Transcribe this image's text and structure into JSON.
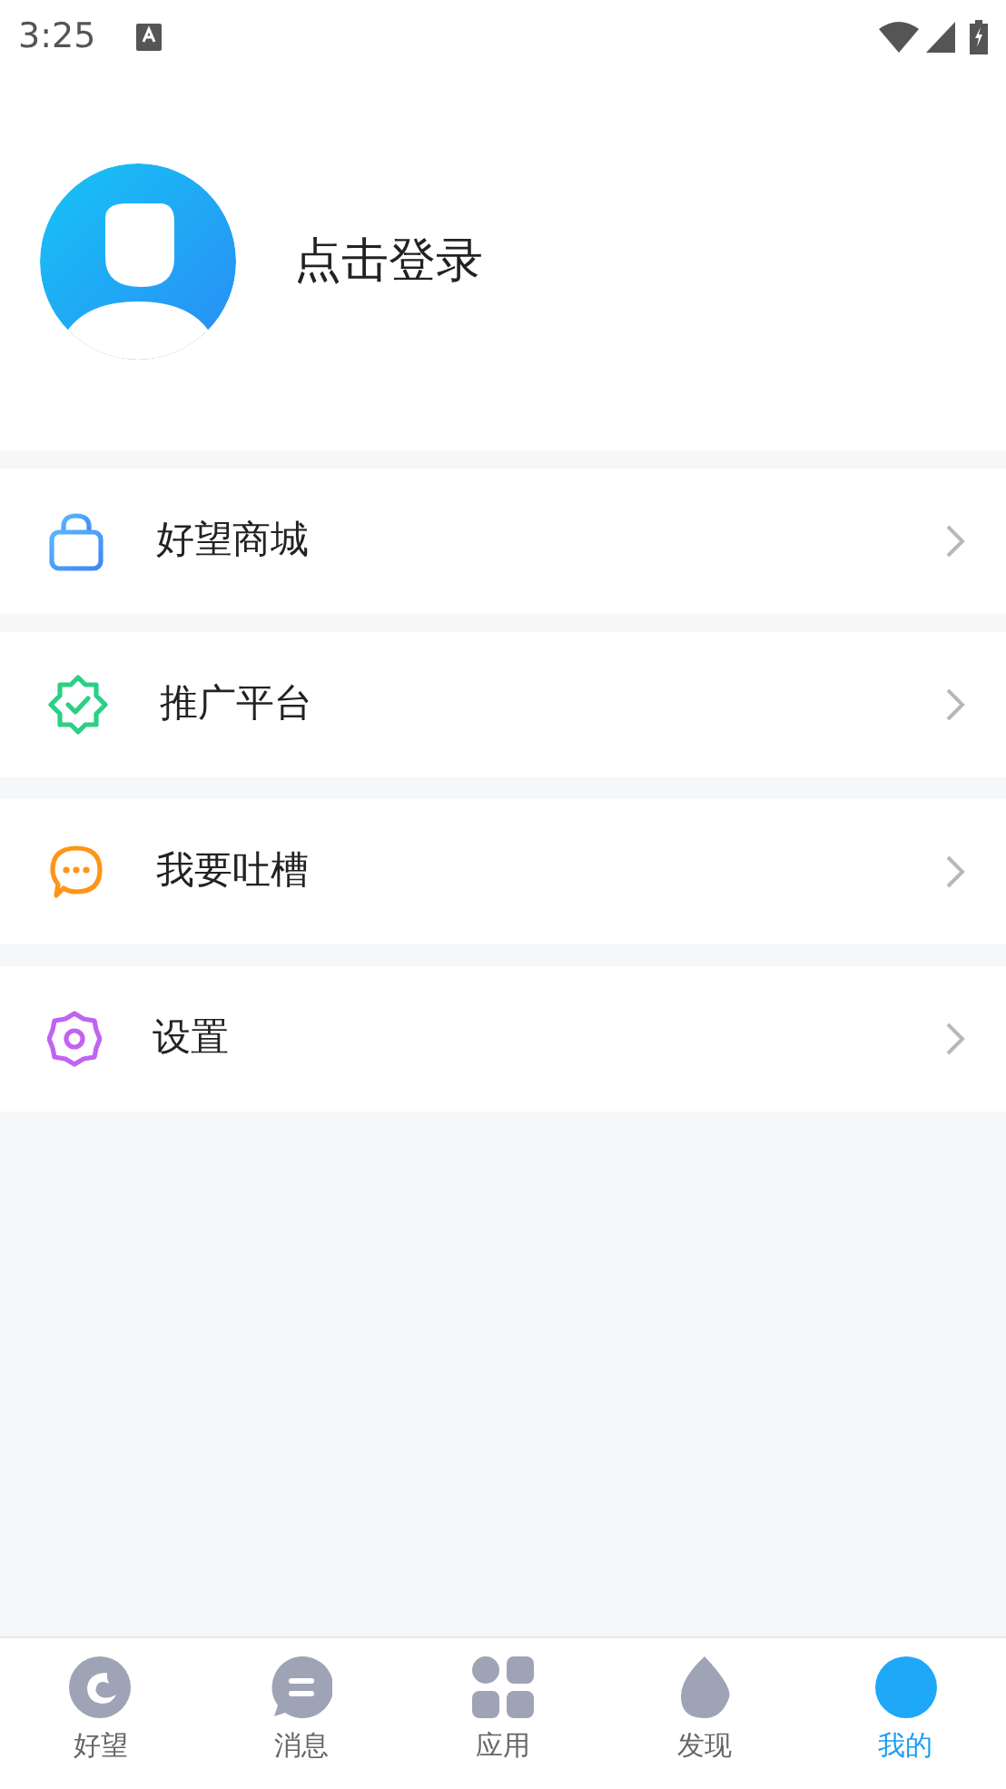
{
  "status_bar": {
    "time": "3:25"
  },
  "profile": {
    "login_text": "点击登录"
  },
  "menu": [
    {
      "kind": "shop",
      "label": "好望商城"
    },
    {
      "kind": "promote",
      "label": "推广平台"
    },
    {
      "kind": "feedback",
      "label": "我要吐槽"
    },
    {
      "kind": "settings",
      "label": "设置"
    }
  ],
  "tab_bar": [
    {
      "kind": "home",
      "label": "好望",
      "selected": false
    },
    {
      "kind": "messages",
      "label": "消息",
      "selected": false
    },
    {
      "kind": "apps",
      "label": "应用",
      "selected": false
    },
    {
      "kind": "discover",
      "label": "发现",
      "selected": false
    },
    {
      "kind": "mine",
      "label": "我的",
      "selected": true
    }
  ]
}
